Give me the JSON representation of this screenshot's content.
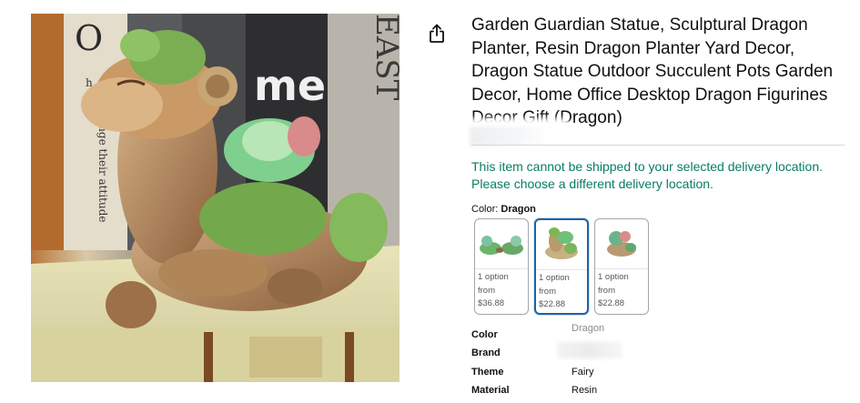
{
  "product": {
    "title": "Garden Guardian Statue, Sculptural Dragon Planter, Resin Dragon Planter Yard Decor, Dragon Statue Outdoor Succulent Pots Garden Decor, Home Office Desktop Dragon Figurines Decor Gift (Dragon)",
    "image_alt": "Wooden-textured resin dragon planter with a succulent on its back, sitting on a stack of books",
    "shipping_message": "This item cannot be shipped to your selected delivery location. Please choose a different delivery location.",
    "book_spine_texts": [
      "EAST",
      "me",
      "ange their attitude",
      "ir",
      "O",
      "h"
    ]
  },
  "color_selector": {
    "label": "Color: ",
    "selected": "Dragon",
    "options": [
      {
        "line1": "1 option",
        "line2": "from",
        "price": "$36.88",
        "selected": false
      },
      {
        "line1": "1 option",
        "line2": "from",
        "price": "$22.88",
        "selected": true
      },
      {
        "line1": "1 option",
        "line2": "from",
        "price": "$22.88",
        "selected": false
      }
    ]
  },
  "specs": [
    {
      "key": "Color",
      "value": "Dragon"
    },
    {
      "key": "Brand",
      "value": ""
    },
    {
      "key": "Theme",
      "value": "Fairy"
    },
    {
      "key": "Material",
      "value": "Resin"
    }
  ],
  "icons": {
    "share": "share-icon"
  },
  "colors": {
    "link_blue": "#2162a1",
    "success_green": "#067d62",
    "divider": "#d5d9d9"
  }
}
